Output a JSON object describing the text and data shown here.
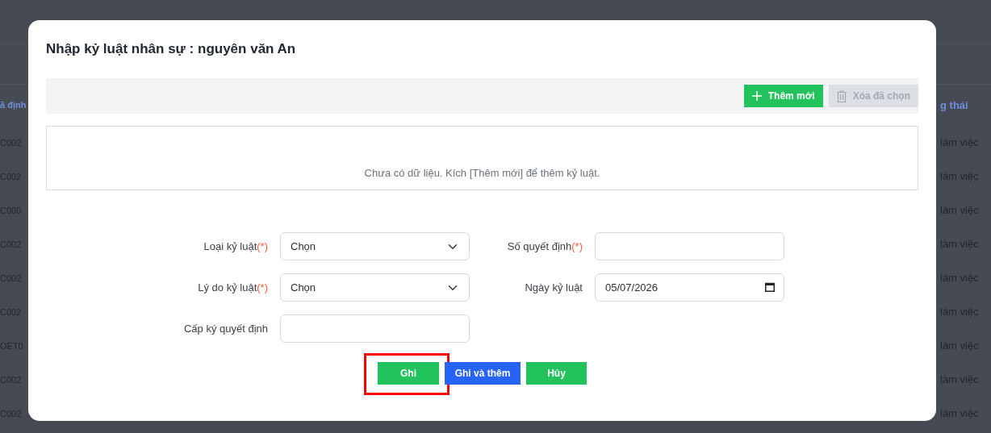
{
  "background": {
    "headers": [
      "ã định",
      "g thái"
    ],
    "rows": [
      {
        "column_1": "C002",
        "column_2": "làm việc"
      },
      {
        "column_1": "C002",
        "column_2": "làm việc"
      },
      {
        "column_1": "C000",
        "column_2": "làm việc"
      },
      {
        "column_1": "C002",
        "column_2": "làm việc"
      },
      {
        "column_1": "C002",
        "column_2": "làm việc"
      },
      {
        "column_1": "C002",
        "column_2": "làm việc"
      },
      {
        "column_1": "OET0",
        "column_2": "làm việc"
      },
      {
        "column_1": "C002",
        "column_2": "làm việc"
      },
      {
        "column_1": "C002",
        "column_2": "làm việc"
      }
    ]
  },
  "dialog": {
    "title": "Nhập kỷ luật nhân sự : nguyên văn An",
    "toolbar": [
      {
        "label": "Thêm mới",
        "kind": "add",
        "disabled": false
      },
      {
        "label": "Xóa đã chọn",
        "kind": "delete",
        "disabled": true
      }
    ],
    "empty_message": "Chưa có dữ liệu. Kích [Thêm mới] để thêm kỷ luật.",
    "fields": [
      {
        "label": "Loại kỷ luật",
        "required_mark": "(*)",
        "kind": "select",
        "value": "Chọn"
      },
      {
        "label": "Số quyết định",
        "required_mark": "(*)",
        "kind": "text"
      },
      {
        "label": "Lý do kỷ luật",
        "required_mark": "(*)",
        "kind": "select",
        "value": "Chọn"
      },
      {
        "label": "Ngày kỷ luật",
        "kind": "date",
        "value": "05/07/2026"
      },
      {
        "label": "Cấp ký quyết định",
        "kind": "text"
      }
    ],
    "buttons": [
      {
        "label": "Ghi",
        "kind": "save",
        "highlighted": true
      },
      {
        "label": "Ghi và thêm",
        "kind": "save_new",
        "highlighted": false
      },
      {
        "label": "Hủy",
        "kind": "cancel",
        "highlighted": false
      }
    ]
  }
}
